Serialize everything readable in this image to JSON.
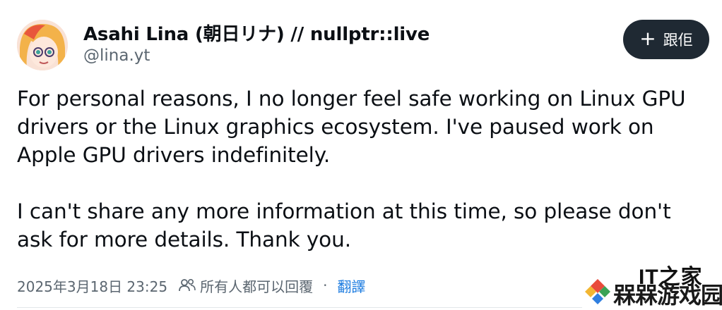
{
  "author": {
    "display_name": "Asahi Lina (朝日リナ) // nullptr::live",
    "handle": "@lina.yt",
    "avatar_icon": "anime-avatar"
  },
  "follow_button": {
    "icon": "plus-icon",
    "label": "跟佢"
  },
  "post": {
    "paragraphs": [
      "For personal reasons, I no longer feel safe working on Linux GPU drivers or the Linux graphics ecosystem. I've paused work on Apple GPU drivers indefinitely.",
      "I can't share any more information at this time, so please don't ask for more details. Thank you."
    ]
  },
  "meta": {
    "timestamp": "2025年3月18日 23:25",
    "reply_icon": "people-icon",
    "reply_setting": "所有人都可以回覆",
    "separator": "·",
    "translate_label": "翻譯"
  },
  "watermark": {
    "top_text": "IT之家",
    "brand_text": "槑槑游戏园"
  },
  "colors": {
    "text": "#0b0f14",
    "secondary": "#5b6670",
    "link": "#1d7ce0",
    "button_bg": "#1f2933"
  }
}
